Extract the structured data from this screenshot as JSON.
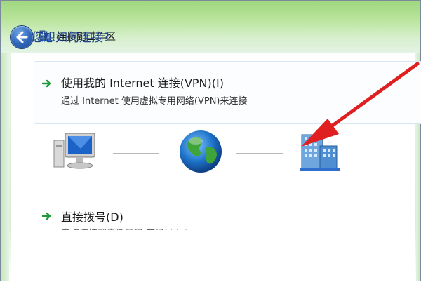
{
  "window": {
    "title": "连接到工作区"
  },
  "main": {
    "heading": "您想如何连接?",
    "options": [
      {
        "title": "使用我的 Internet 连接(VPN)(I)",
        "description": "通过 Internet 使用虚拟专用网络(VPN)来连接"
      },
      {
        "title": "直接拨号(D)",
        "description": "直接连接到电话号码,不经过 Internet。"
      }
    ]
  },
  "colors": {
    "heading": "#1e3e8f",
    "annotation_arrow": "#e02020",
    "option_arrow": "#1f9a3a"
  },
  "icons": {
    "back": "back-arrow-icon",
    "title": "workplace-network-icon",
    "computer": "computer-icon",
    "internet": "globe-icon",
    "workplace": "office-building-icon"
  }
}
